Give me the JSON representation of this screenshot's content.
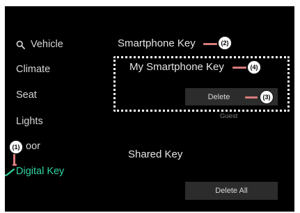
{
  "sidebar": {
    "search_label": "Vehicle",
    "items": [
      {
        "label": "Climate"
      },
      {
        "label": "Seat"
      },
      {
        "label": "Lights"
      },
      {
        "label": "oor"
      },
      {
        "label": "Digital Key",
        "active": true
      }
    ]
  },
  "main": {
    "smartphone_key_heading": "Smartphone Key",
    "my_smartphone_key": "My Smartphone Key",
    "delete_label": "Delete",
    "guest_label": "Guest",
    "shared_key_heading": "Shared Key",
    "delete_all_label": "Delete All"
  },
  "callouts": {
    "c1": "(1)",
    "c2": "(2)",
    "c3": "(3)",
    "c4": "(4)"
  },
  "colors": {
    "background": "#000000",
    "accent_active": "#2fd3a0",
    "callout_leader": "#d97b7b",
    "button_bg": "#2c2c2c"
  }
}
